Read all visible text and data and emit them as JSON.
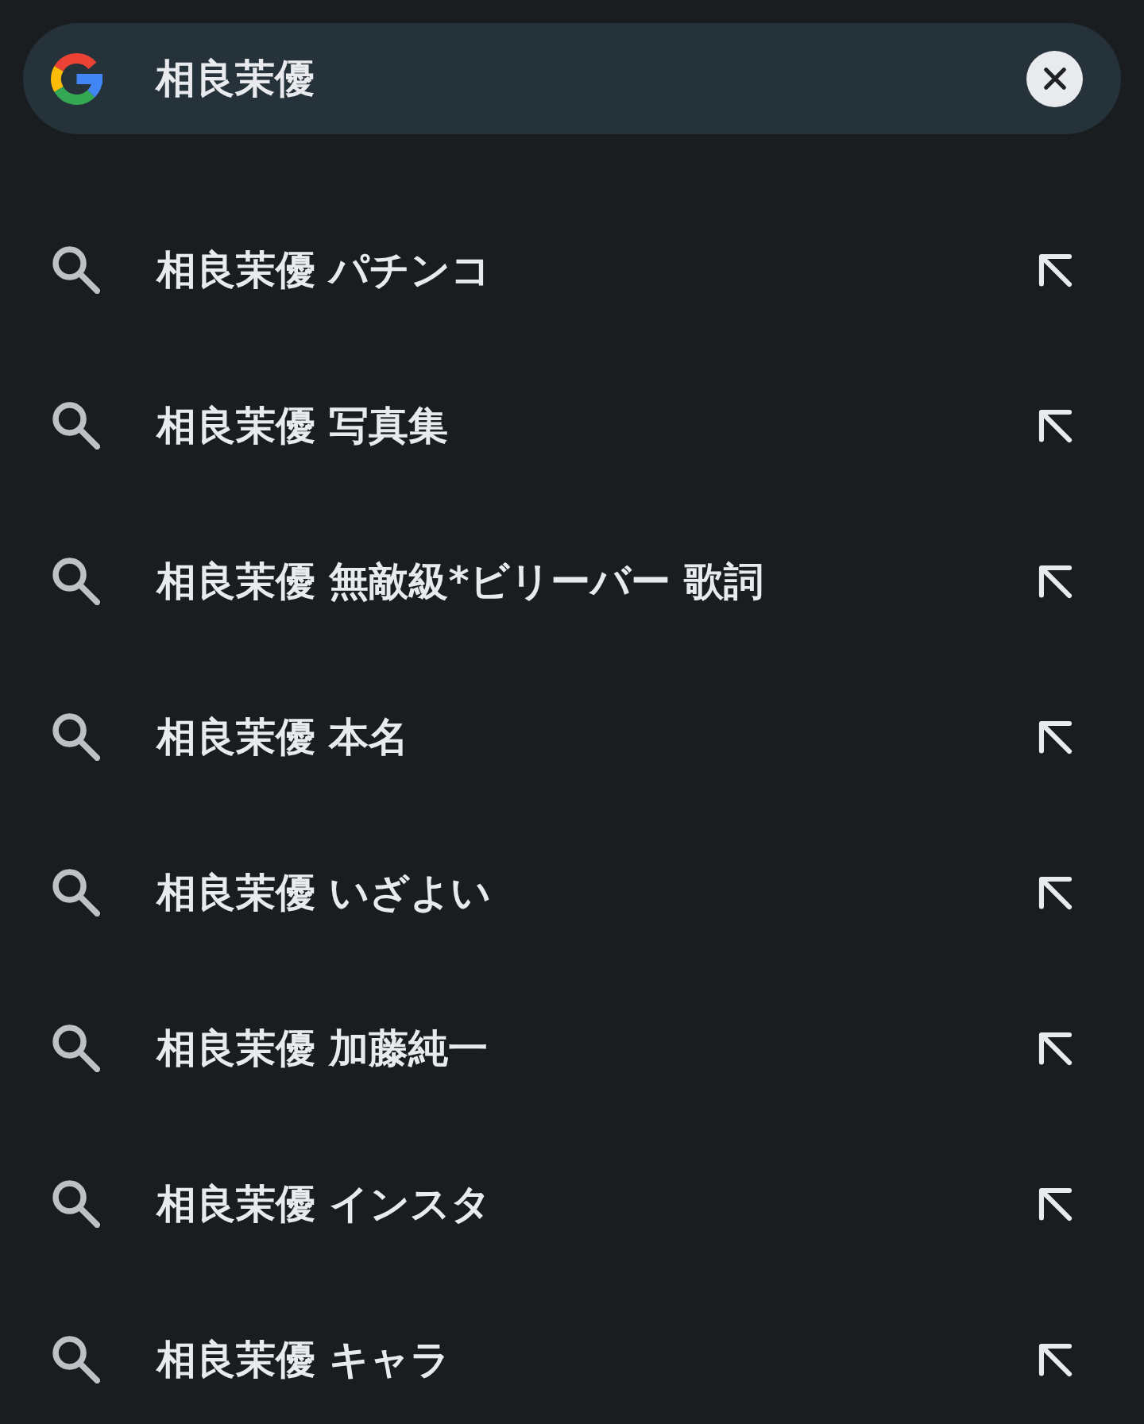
{
  "search_bar": {
    "value": "相良茉優"
  },
  "suggestions": [
    {
      "text": "相良茉優 パチンコ"
    },
    {
      "text": "相良茉優 写真集"
    },
    {
      "text": "相良茉優 無敵級*ビリーバー 歌詞"
    },
    {
      "text": "相良茉優 本名"
    },
    {
      "text": "相良茉優 いざよい"
    },
    {
      "text": "相良茉優 加藤純一"
    },
    {
      "text": "相良茉優 インスタ"
    },
    {
      "text": "相良茉優 キャラ"
    }
  ]
}
